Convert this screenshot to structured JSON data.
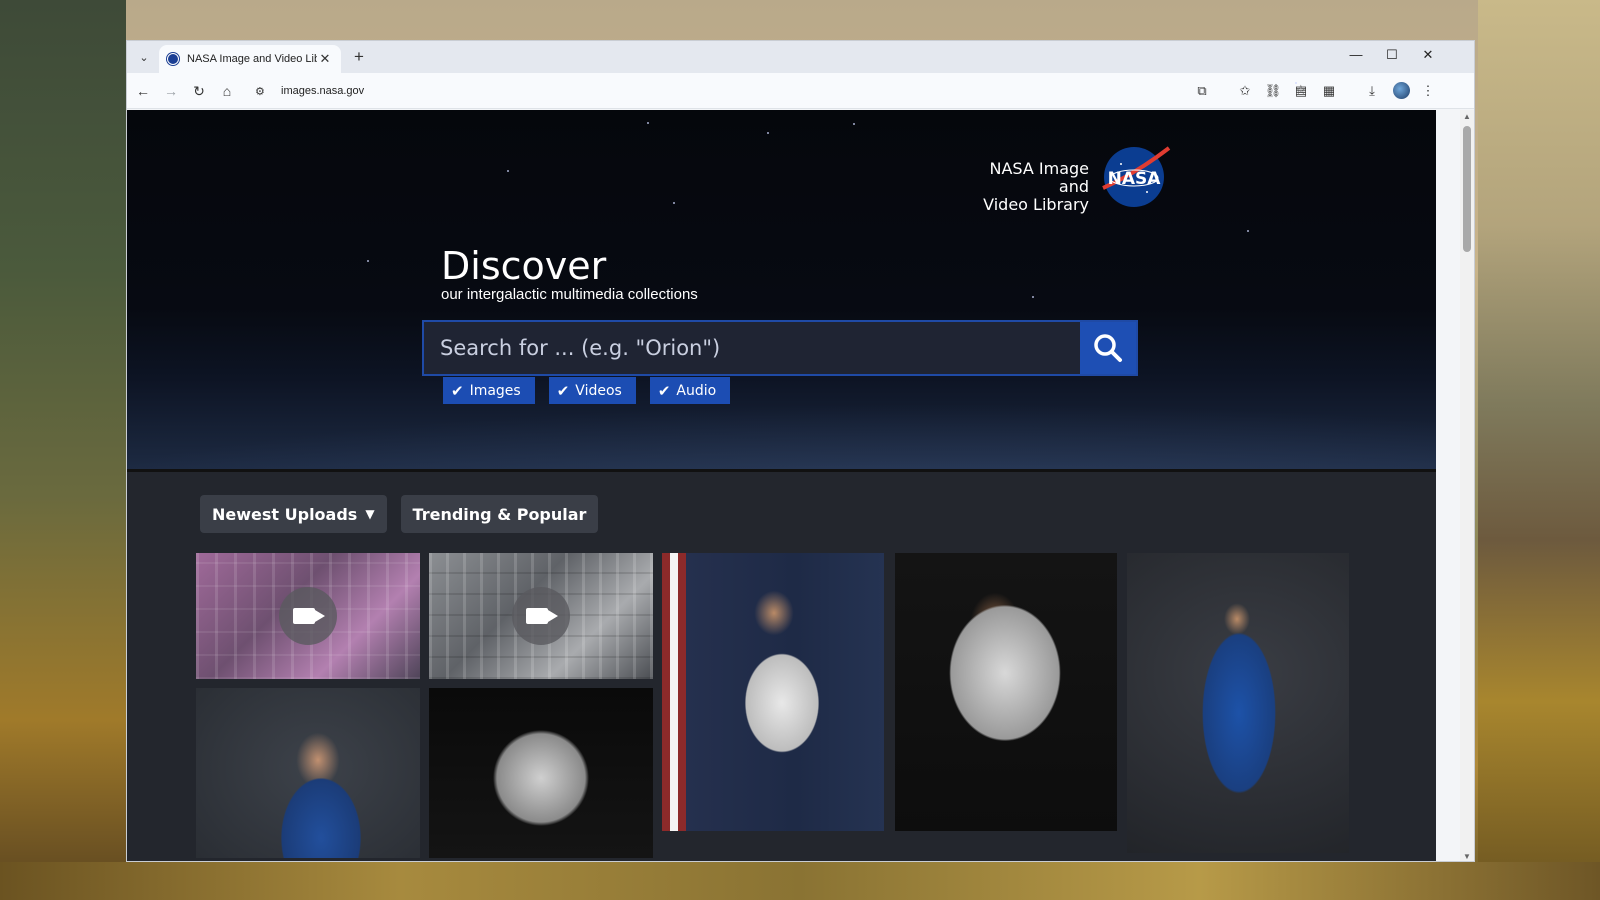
{
  "browser": {
    "tab_title": "NASA Image and Video Library",
    "url": "images.nasa.gov",
    "new_tab": "+",
    "close_tab": "✕",
    "window_controls": {
      "minimize": "—",
      "maximize": "☐",
      "close": "✕"
    }
  },
  "site": {
    "brand_line1": "NASA Image and",
    "brand_line2": "Video Library",
    "logo_text": "NASA"
  },
  "hero": {
    "heading": "Discover",
    "tagline": "our intergalactic multimedia collections",
    "search": {
      "placeholder": "Search for ... (e.g. \"Orion\")",
      "value": ""
    },
    "filters": [
      {
        "label": "Images",
        "checked": true
      },
      {
        "label": "Videos",
        "checked": true
      },
      {
        "label": "Audio",
        "checked": true
      }
    ]
  },
  "sections": {
    "tabs": [
      {
        "label": "Newest Uploads",
        "active": true
      },
      {
        "label": "Trending & Popular",
        "active": false
      }
    ]
  },
  "gallery": [
    {
      "type": "video",
      "subject": "ISS interior crew activity"
    },
    {
      "type": "video",
      "subject": "ISS crew members"
    },
    {
      "type": "image",
      "subject": "Astronaut in spacesuit with US flag"
    },
    {
      "type": "image",
      "subject": "Astronaut portrait in spacesuit"
    },
    {
      "type": "image",
      "subject": "Astronaut in blue flight suit seated"
    },
    {
      "type": "image",
      "subject": "Astronaut portrait blue flight suit"
    },
    {
      "type": "image",
      "subject": "Astronaut in helmet"
    }
  ],
  "colors": {
    "accent": "#1e4fb4",
    "page_bg": "#23262d",
    "pill_bg": "#3a3e47"
  }
}
